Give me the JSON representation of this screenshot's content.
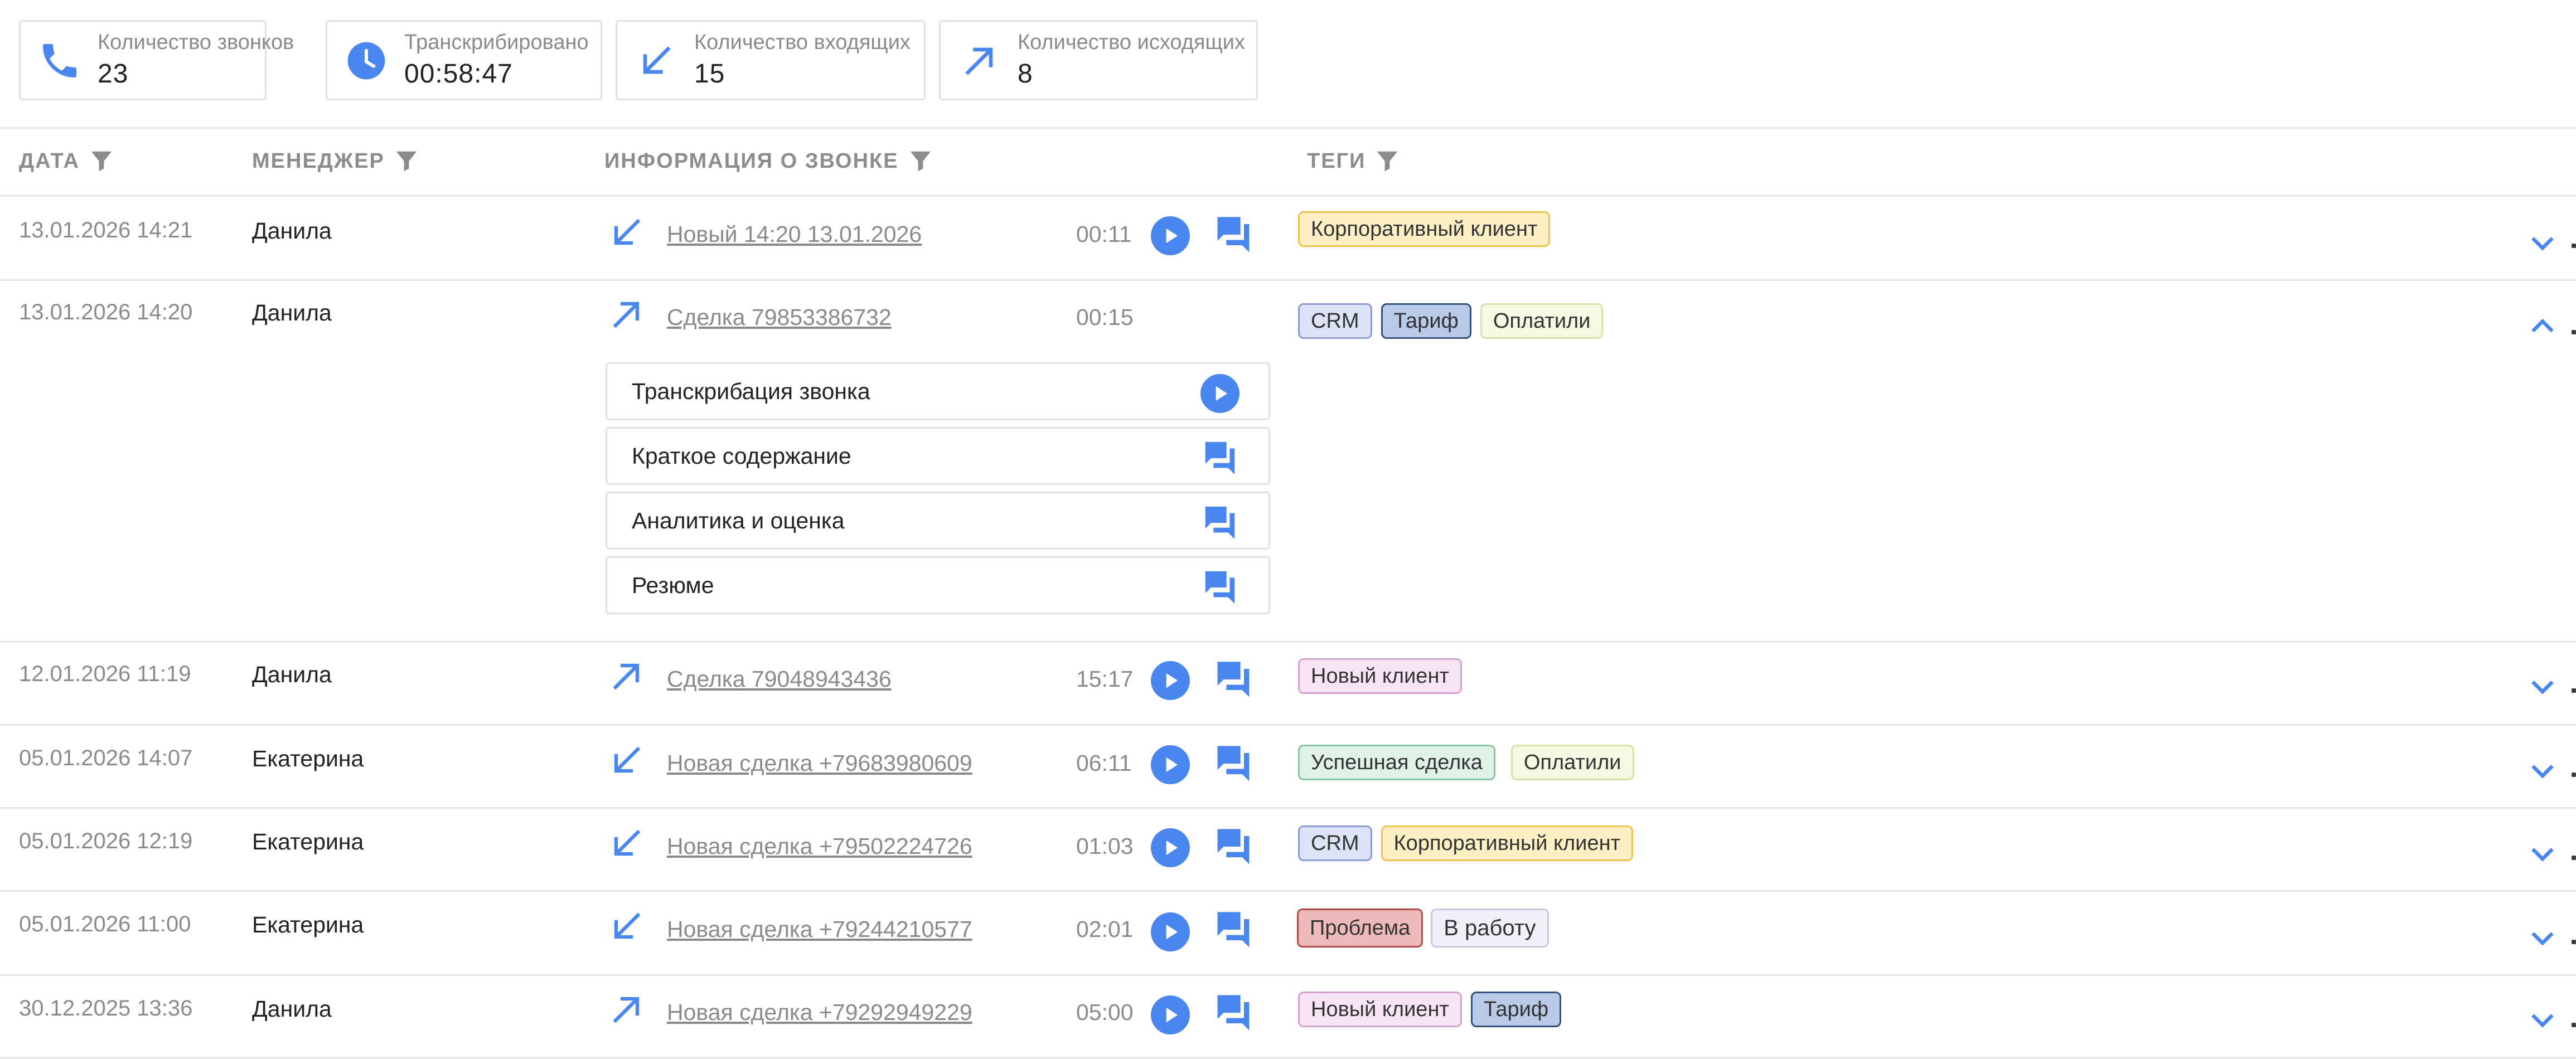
{
  "stats": [
    {
      "label": "Количество звонков",
      "value": "23",
      "icon": "phone-icon"
    },
    {
      "label": "Транскрибировано",
      "value": "00:58:47",
      "icon": "clock-icon"
    },
    {
      "label": "Количество входящих",
      "value": "15",
      "icon": "incoming-arrow-icon"
    },
    {
      "label": "Количество исходящих",
      "value": "8",
      "icon": "outgoing-arrow-icon"
    }
  ],
  "table": {
    "headers": {
      "date": "ДАТА",
      "manager": "МЕНЕДЖЕР",
      "info": "ИНФОРМАЦИЯ О ЗВОНКЕ",
      "tags": "ТЕГИ"
    },
    "rows": [
      {
        "date": "13.01.2026 14:21",
        "manager": "Данила",
        "direction": "incoming",
        "title": "Новый 14:20 13.01.2026",
        "duration": "00:11",
        "tags": [
          {
            "text": "Корпоративный клиент",
            "style": "yellow"
          }
        ],
        "expanded": false
      },
      {
        "date": "13.01.2026 14:20",
        "manager": "Данила",
        "direction": "outgoing",
        "title": "Сделка 79853386732",
        "duration": "00:15",
        "tags": [
          {
            "text": "CRM",
            "style": "blue"
          },
          {
            "text": "Тариф",
            "style": "darkblue"
          },
          {
            "text": "Оплатили",
            "style": "lime"
          }
        ],
        "expanded": true
      },
      {
        "date": "12.01.2026 11:19",
        "manager": "Данила",
        "direction": "outgoing",
        "title": "Сделка 79048943436",
        "duration": "15:17",
        "tags": [
          {
            "text": "Новый клиент",
            "style": "pink"
          }
        ],
        "expanded": false
      },
      {
        "date": "05.01.2026 14:07",
        "manager": "Екатерина",
        "direction": "incoming",
        "title": "Новая сделка +79683980609",
        "duration": "06:11",
        "tags": [
          {
            "text": "Успешная сделка",
            "style": "green"
          },
          {
            "text": "Оплатили",
            "style": "lime"
          }
        ],
        "expanded": false
      },
      {
        "date": "05.01.2026 12:19",
        "manager": "Екатерина",
        "direction": "incoming",
        "title": "Новая сделка +79502224726",
        "duration": "01:03",
        "tags": [
          {
            "text": "CRM",
            "style": "blue"
          },
          {
            "text": "Корпоративный клиент",
            "style": "yellow"
          }
        ],
        "expanded": false
      },
      {
        "date": "05.01.2026 11:00",
        "manager": "Екатерина",
        "direction": "incoming",
        "title": "Новая сделка +79244210577",
        "duration": "02:01",
        "tags": [
          {
            "text": "Проблема",
            "style": "red"
          },
          {
            "text": "В работу",
            "style": "lavender"
          }
        ],
        "expanded": false
      },
      {
        "date": "30.12.2025 13:36",
        "manager": "Данила",
        "direction": "outgoing",
        "title": "Новая сделка +79292949229",
        "duration": "05:00",
        "tags": [
          {
            "text": "Новый клиент",
            "style": "pink"
          },
          {
            "text": "Тариф",
            "style": "darkblue"
          }
        ],
        "expanded": false
      }
    ],
    "expanded_panel": [
      {
        "label": "Транскрибация звонка",
        "icon": "play-icon"
      },
      {
        "label": "Краткое содержание",
        "icon": "chat-icon"
      },
      {
        "label": "Аналитика и оценка",
        "icon": "chat-icon"
      },
      {
        "label": "Резюме",
        "icon": "chat-icon"
      }
    ]
  },
  "colors": {
    "accent": "#4a86f0",
    "muted_text": "#8a8a8a",
    "tag_yellow_bg": "#fdf0c4",
    "tag_yellow_border": "#f1c24e",
    "tag_blue_bg": "#dde3f6",
    "tag_blue_border": "#8b9cd6",
    "tag_darkblue_bg": "#b9c9e8",
    "tag_darkblue_border": "#33527e",
    "tag_lime_bg": "#f6f8e2",
    "tag_lime_border": "#d6e2a6",
    "tag_pink_bg": "#f7e4f4",
    "tag_pink_border": "#d6a2d1",
    "tag_green_bg": "#e0f1e8",
    "tag_green_border": "#8ac4a4",
    "tag_red_bg": "#eeb9b9",
    "tag_red_border": "#b34a4a",
    "tag_lavender_bg": "#f3eff9",
    "tag_lavender_border": "#cfc4e4"
  }
}
